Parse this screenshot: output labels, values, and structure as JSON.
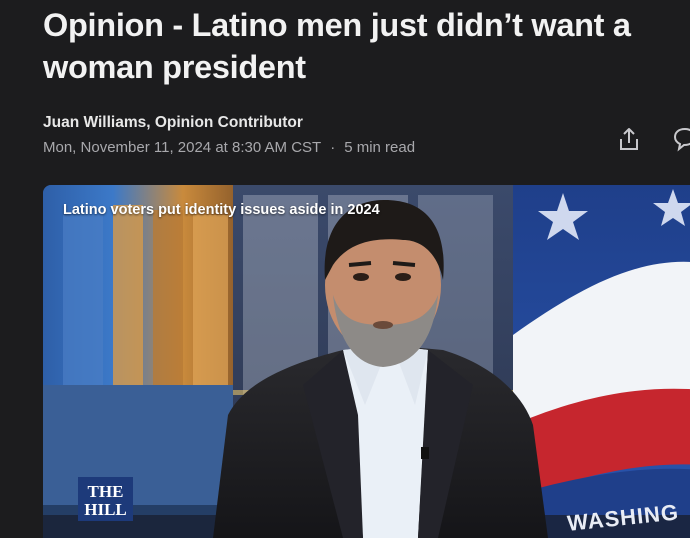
{
  "article": {
    "title_line1": "Opinion - Latino men just didn’t want a",
    "title_line2": "woman president",
    "author": "Juan Williams, Opinion Contributor",
    "date": "Mon, November 11, 2024 at 8:30 AM CST",
    "separator": "·",
    "read_time": "5 min read"
  },
  "actions": {
    "share_icon": "share-icon",
    "comment_icon": "comment-icon"
  },
  "video": {
    "caption": "Latino voters put identity issues aside in 2024",
    "logo_text": "THE HILL",
    "backdrop_text": "WASHING"
  },
  "colors": {
    "background": "#1c1c1e",
    "title": "#f2f2f2",
    "meta": "#a8a8ac",
    "logo_bg": "#1d3a7a"
  }
}
